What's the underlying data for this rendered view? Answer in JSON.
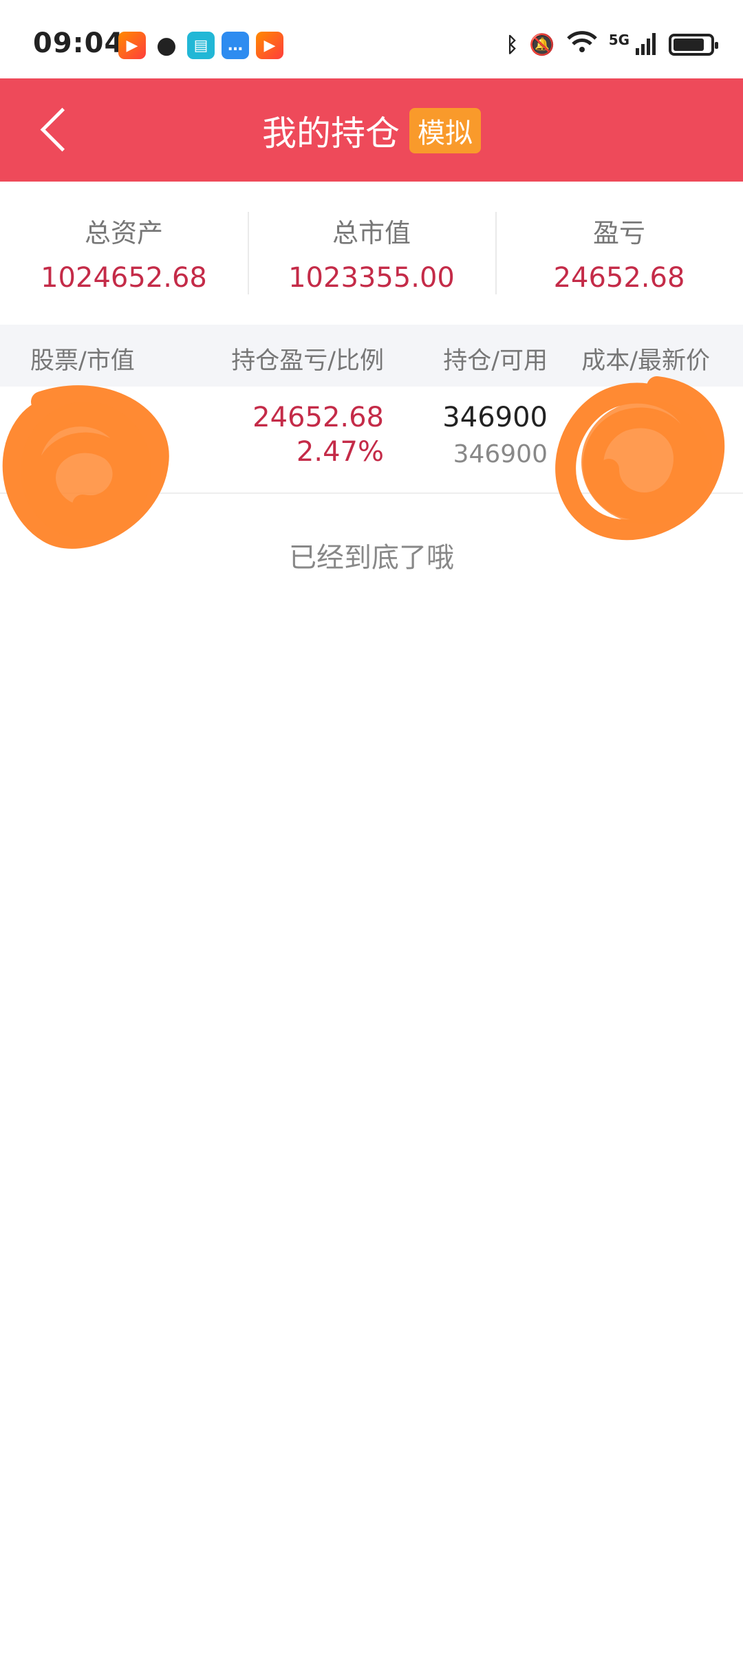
{
  "status_bar": {
    "time": "09:04",
    "notification_icons": [
      "kuaishou-icon",
      "wechat-icon",
      "book-icon",
      "message-icon",
      "kuaishou-icon"
    ],
    "system_icons": [
      "bluetooth-icon",
      "mute-icon",
      "wifi-icon",
      "5g-signal-icon",
      "battery-icon"
    ],
    "network_label": "5G"
  },
  "header": {
    "title": "我的持仓",
    "badge": "模拟",
    "background_color": "#ee4a5a",
    "badge_color": "#f99a2b"
  },
  "summary": [
    {
      "label": "总资产",
      "value": "1024652.68"
    },
    {
      "label": "总市值",
      "value": "1023355.00"
    },
    {
      "label": "盈亏",
      "value": "24652.68"
    }
  ],
  "table": {
    "columns": [
      "股票/市值",
      "持仓盈亏/比例",
      "持仓/可用",
      "成本/最新价"
    ],
    "rows": [
      {
        "pnl": "24652.68",
        "pnl_ratio": "2.47%",
        "position": "346900",
        "available": "346900"
      }
    ]
  },
  "footer_note": "已经到底了哦",
  "colors": {
    "profit": "#c42b48",
    "redaction": "#ff8a33"
  }
}
